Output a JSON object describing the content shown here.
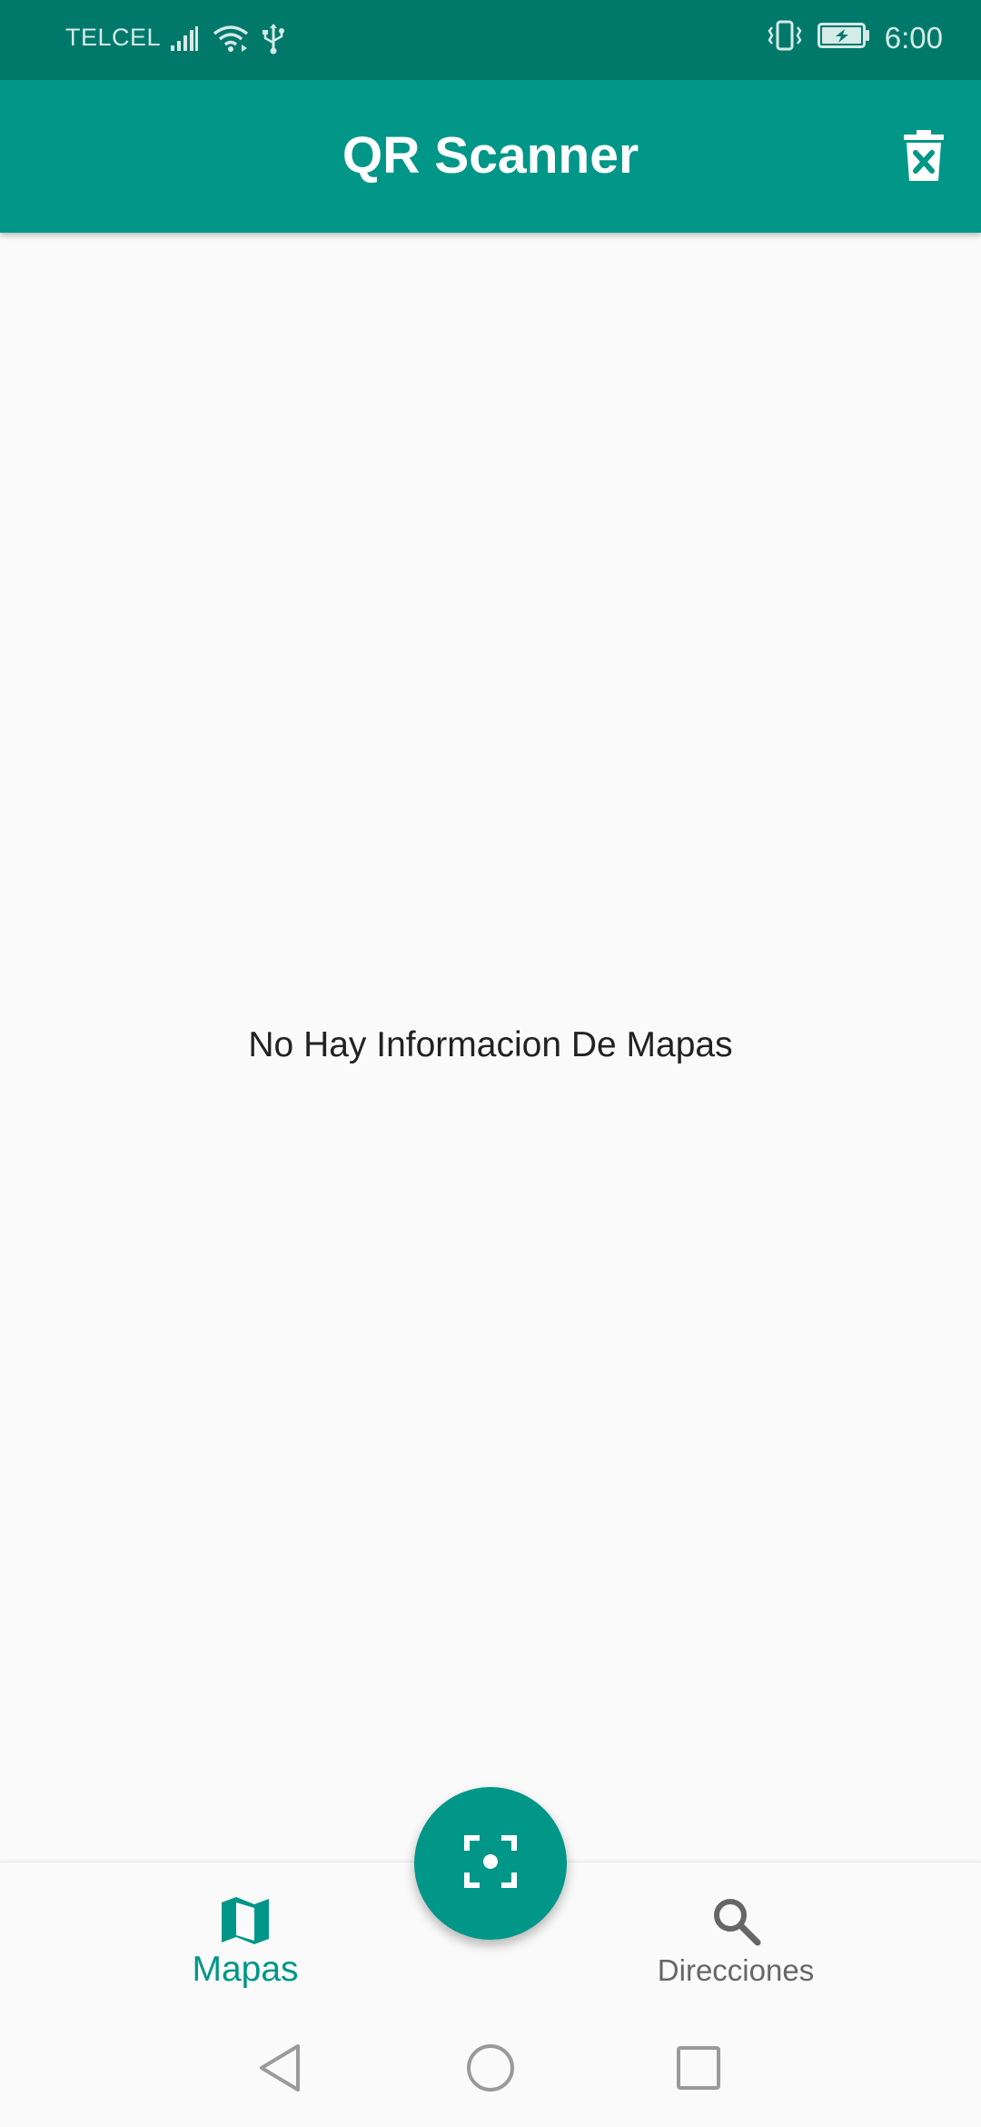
{
  "status_bar": {
    "carrier": "TELCEL",
    "time": "6:00",
    "icons": [
      "signal-icon",
      "wifi-icon",
      "usb-icon",
      "vibrate-icon",
      "battery-charging-icon"
    ]
  },
  "app_bar": {
    "title": "QR Scanner",
    "action_icon": "delete-forever-icon"
  },
  "main": {
    "empty_message": "No Hay Informacion De Mapas"
  },
  "fab": {
    "icon": "center-focus-icon"
  },
  "bottom_nav": {
    "items": [
      {
        "label": "Mapas",
        "icon": "map-icon",
        "active": true
      },
      {
        "label": "Direcciones",
        "icon": "search-icon",
        "active": false
      }
    ]
  },
  "system_nav": {
    "buttons": [
      "back-icon",
      "home-icon",
      "recents-icon"
    ]
  },
  "colors": {
    "status_bar": "#00796b",
    "primary": "#009688",
    "background": "#fafafa",
    "inactive": "#666666"
  }
}
